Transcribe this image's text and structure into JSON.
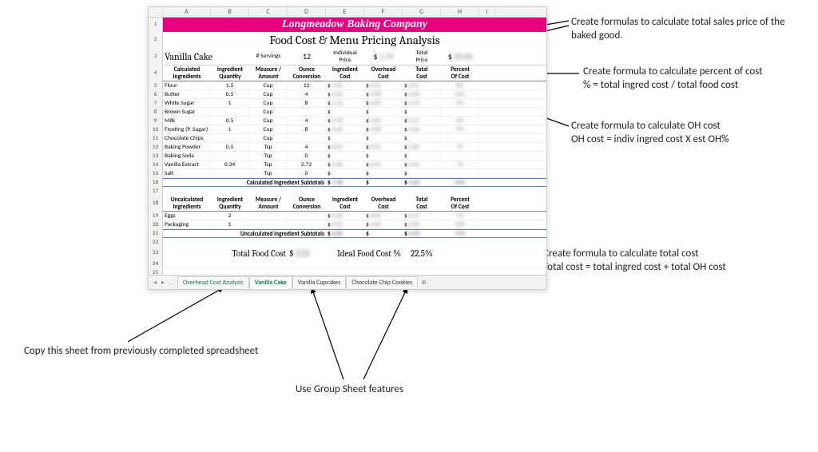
{
  "company": "Longmeadow Baking Company",
  "title": "Food Cost & Menu Pricing Analysis",
  "product": "Vanilla Cake",
  "servings_label": "# Servings",
  "servings": "12",
  "indiv_price_label": "Individual\nPrice",
  "indiv_price_prefix": "$",
  "indiv_price_blur": "1.75",
  "total_price_label": "Total\nPrice",
  "total_price_prefix": "$",
  "total_price_blur": "20.00",
  "cols": {
    "calc": "Calculated\nIngredients",
    "qty": "Ingredient\nQuantity",
    "measure": "Measure /\nAmount",
    "ounce": "Ounce\nConversion",
    "ingcost": "Ingredient\nCost",
    "ohcost": "Overhead\nCost",
    "totcost": "Total\nCost",
    "pct": "Percent\nOf Cost",
    "uncalc": "Uncalculated\nIngredients"
  },
  "ingredients": [
    {
      "name": "Flour",
      "qty": "1.5",
      "measure": "Cup",
      "oz": "12",
      "ic": "0.30",
      "oh": "0.05",
      "tc": "0.35",
      "pc": "8%"
    },
    {
      "name": "Butter",
      "qty": "0.5",
      "measure": "Cup",
      "oz": "4",
      "ic": "0.50",
      "oh": "0.08",
      "tc": "0.58",
      "pc": "10%"
    },
    {
      "name": "White Sugar",
      "qty": "1",
      "measure": "Cup",
      "oz": "8",
      "ic": "0.25",
      "oh": "0.04",
      "tc": "0.29",
      "pc": "5%"
    },
    {
      "name": "Brown Sugar",
      "qty": "",
      "measure": "Cup",
      "oz": "",
      "ic": "",
      "oh": "",
      "tc": "",
      "pc": ""
    },
    {
      "name": "Milk",
      "qty": "0.5",
      "measure": "Cup",
      "oz": "4",
      "ic": "0.18",
      "oh": "0.03",
      "tc": "0.21",
      "pc": "4%"
    },
    {
      "name": "Frosting (P. Sugar)",
      "qty": "1",
      "measure": "Cup",
      "oz": "8",
      "ic": "0.40",
      "oh": "0.06",
      "tc": "0.46",
      "pc": "9%"
    },
    {
      "name": "Chocolate Chips",
      "qty": "",
      "measure": "Cup",
      "oz": "",
      "ic": "",
      "oh": "",
      "tc": "",
      "pc": ""
    },
    {
      "name": "Baking Powder",
      "qty": "0.5",
      "measure": "Tsp",
      "oz": "4",
      "ic": "0.05",
      "oh": "0.01",
      "tc": "0.06",
      "pc": "1%"
    },
    {
      "name": "Baking Soda",
      "qty": "",
      "measure": "Tsp",
      "oz": "0",
      "ic": "",
      "oh": "",
      "tc": "",
      "pc": ""
    },
    {
      "name": "Vanilla Extract",
      "qty": "0.34",
      "measure": "Tsp",
      "oz": "2.72",
      "ic": "0.30",
      "oh": "0.05",
      "tc": "0.35",
      "pc": "7%"
    },
    {
      "name": "Salt",
      "qty": "",
      "measure": "Tsp",
      "oz": "0",
      "ic": "",
      "oh": "",
      "tc": "",
      "pc": ""
    }
  ],
  "calc_subtotal_label": "Calculated Ingredient Subtotals",
  "calc_sub": {
    "ic": "1.98",
    "oh": "",
    "tc": "2.30",
    "pc": "44%"
  },
  "uncalc": [
    {
      "name": "Eggs",
      "qty": "2",
      "measure": "",
      "oz": "",
      "ic": "0.30",
      "oh": "0.05",
      "tc": "0.35",
      "pc": "7%"
    },
    {
      "name": "Packaging",
      "qty": "1",
      "measure": "",
      "oz": "",
      "ic": "0.50",
      "oh": "0.08",
      "tc": "0.58",
      "pc": "10%"
    }
  ],
  "uncalc_subtotal_label": "Uncalculated ingredient Subtotals",
  "uncalc_sub": {
    "ic": "0.80",
    "oh": "",
    "tc": "0.93",
    "pc": "17%"
  },
  "total_food_cost_label": "Total Food Cost",
  "total_food_cost_prefix": "$",
  "total_food_cost_blur": "3.23",
  "ideal_pct_label": "Ideal Food Cost %",
  "ideal_pct": "22.5%",
  "dollar": "$",
  "tabs": {
    "overhead": "Overhead Cost Analysis",
    "vanilla_cake": "Vanilla Cake",
    "vanilla_cupcakes": "Vanilla Cupcakes",
    "choc_chip": "Chocolate Chip Cookies"
  },
  "col_letters": [
    "A",
    "B",
    "C",
    "D",
    "E",
    "F",
    "G",
    "H",
    "I"
  ],
  "annotations": {
    "sales_price": "Create formulas to calculate total sales price of the baked good.",
    "pct_cost_1": "Create formula to calculate percent of cost",
    "pct_cost_2": "% = total ingred cost / total food cost",
    "oh_cost_1": "Create formula to calculate OH cost",
    "oh_cost_2": "OH cost = indiv ingred cost X est OH%",
    "total_cost_1": "Create formula to calculate total cost",
    "total_cost_2": "Total cost = total ingred cost + total OH cost",
    "copy_sheet": "Copy this sheet from previously completed spreadsheet",
    "group_sheet": "Use Group Sheet features"
  }
}
